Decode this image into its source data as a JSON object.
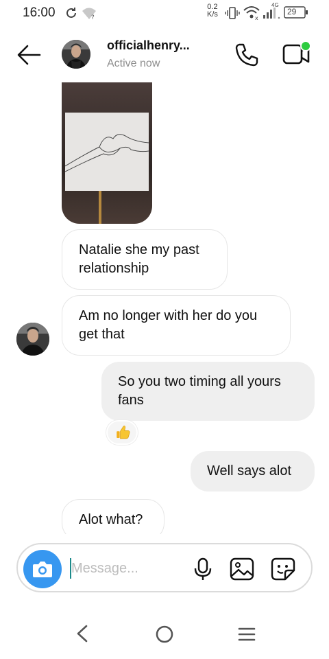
{
  "status_bar": {
    "time": "16:00",
    "net_speed_value": "0.2",
    "net_speed_unit": "K/s",
    "network_type": "4G",
    "battery": "29",
    "icons": [
      "sync-icon",
      "wifi-question-icon",
      "vibrate-icon",
      "wifi-icon",
      "signal-icon",
      "battery-icon"
    ]
  },
  "header": {
    "contact_name": "officialhenry...",
    "status": "Active now",
    "online_dot_color": "#2ecc40"
  },
  "messages": [
    {
      "from": "them",
      "type": "image"
    },
    {
      "from": "them",
      "text": "Natalie she my past relationship"
    },
    {
      "from": "them",
      "text": "Am no longer with her do you get that",
      "show_avatar": true
    },
    {
      "from": "me",
      "text": "So you two timing all yours fans",
      "reaction": "👍"
    },
    {
      "from": "me",
      "text": "Well says alot"
    },
    {
      "from": "them",
      "text": "Alot what?"
    }
  ],
  "composer": {
    "placeholder": "Message...",
    "value": "",
    "camera_color": "#3797f0"
  },
  "nav": {
    "icons": [
      "back-icon",
      "home-icon",
      "menu-icon"
    ]
  }
}
